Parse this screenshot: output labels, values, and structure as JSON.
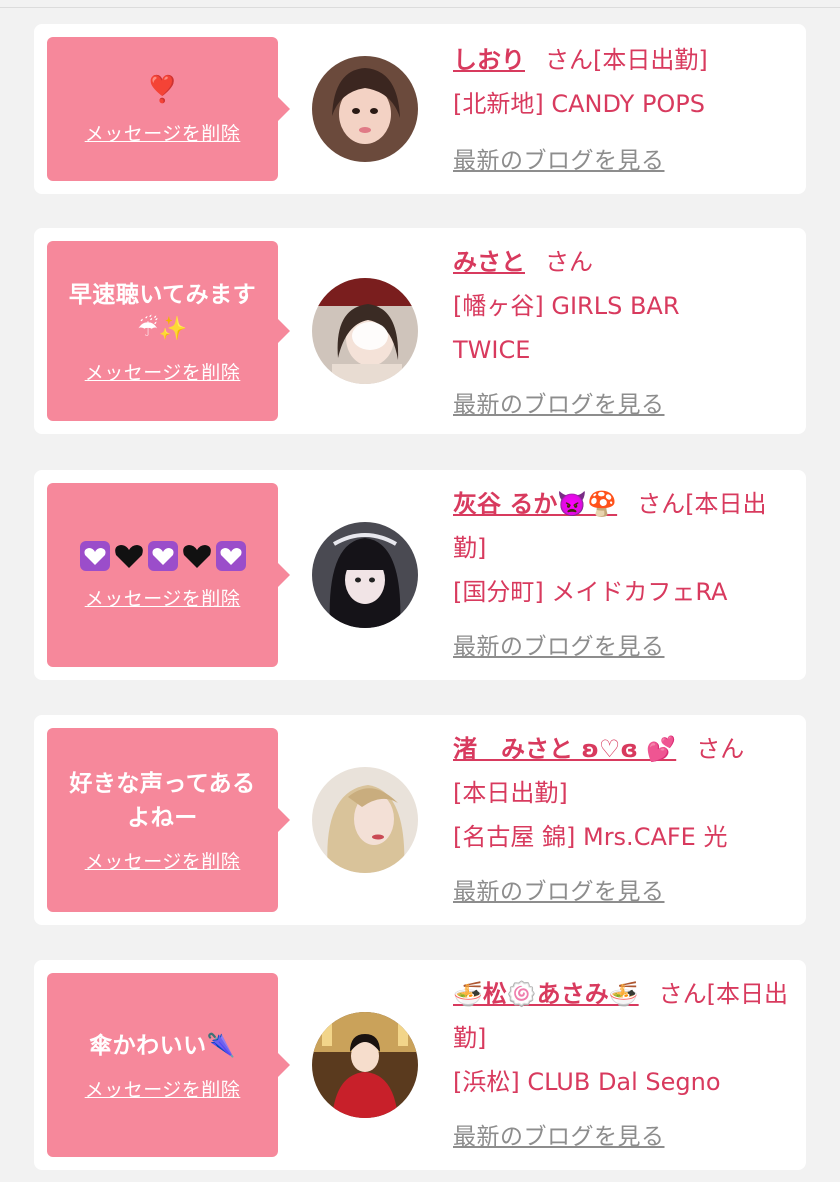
{
  "delete_label": "メッセージを削除",
  "blog_label": "最新のブログを見る",
  "honorific": "さん",
  "colors": {
    "bubble": "#f6889b",
    "accent": "#d83a5e",
    "link_gray": "#8d8d8d",
    "card_bg": "#ffffff",
    "page_bg": "#f2f2f2"
  },
  "items": [
    {
      "message_line1": "❣️",
      "message_line2": "",
      "name": "しおり",
      "status": "[本日出勤]",
      "shop": "[北新地] CANDY POPS",
      "avatar_icon": "woman-portrait-icon"
    },
    {
      "message_line1": "早速聴いてみます",
      "message_line2": "☔✨",
      "name": "みさと",
      "status": "",
      "shop": "[幡ヶ谷] GIRLS BAR TWICE",
      "avatar_icon": "woman-portrait-icon"
    },
    {
      "message_line1": "",
      "message_line2": "",
      "hearts": [
        "purple",
        "black",
        "purple",
        "black",
        "purple"
      ],
      "name": "灰谷 るか👿🍄",
      "status": "[本日出勤]",
      "shop": "[国分町] メイドカフェRA",
      "avatar_icon": "woman-portrait-icon"
    },
    {
      "message_line1": "好きな声ってある",
      "message_line2": "よねー",
      "name": "渚　みさと ʚ♡ɞ 💕",
      "status": "[本日出勤]",
      "shop": "[名古屋 錦] Mrs.CAFE 光",
      "avatar_icon": "woman-portrait-icon"
    },
    {
      "message_line1": "傘かわいい🌂",
      "message_line2": "",
      "name": "🍜松🍥あさみ🍜",
      "status": "[本日出勤]",
      "shop": "[浜松] CLUB Dal Segno",
      "avatar_icon": "woman-portrait-icon"
    }
  ]
}
